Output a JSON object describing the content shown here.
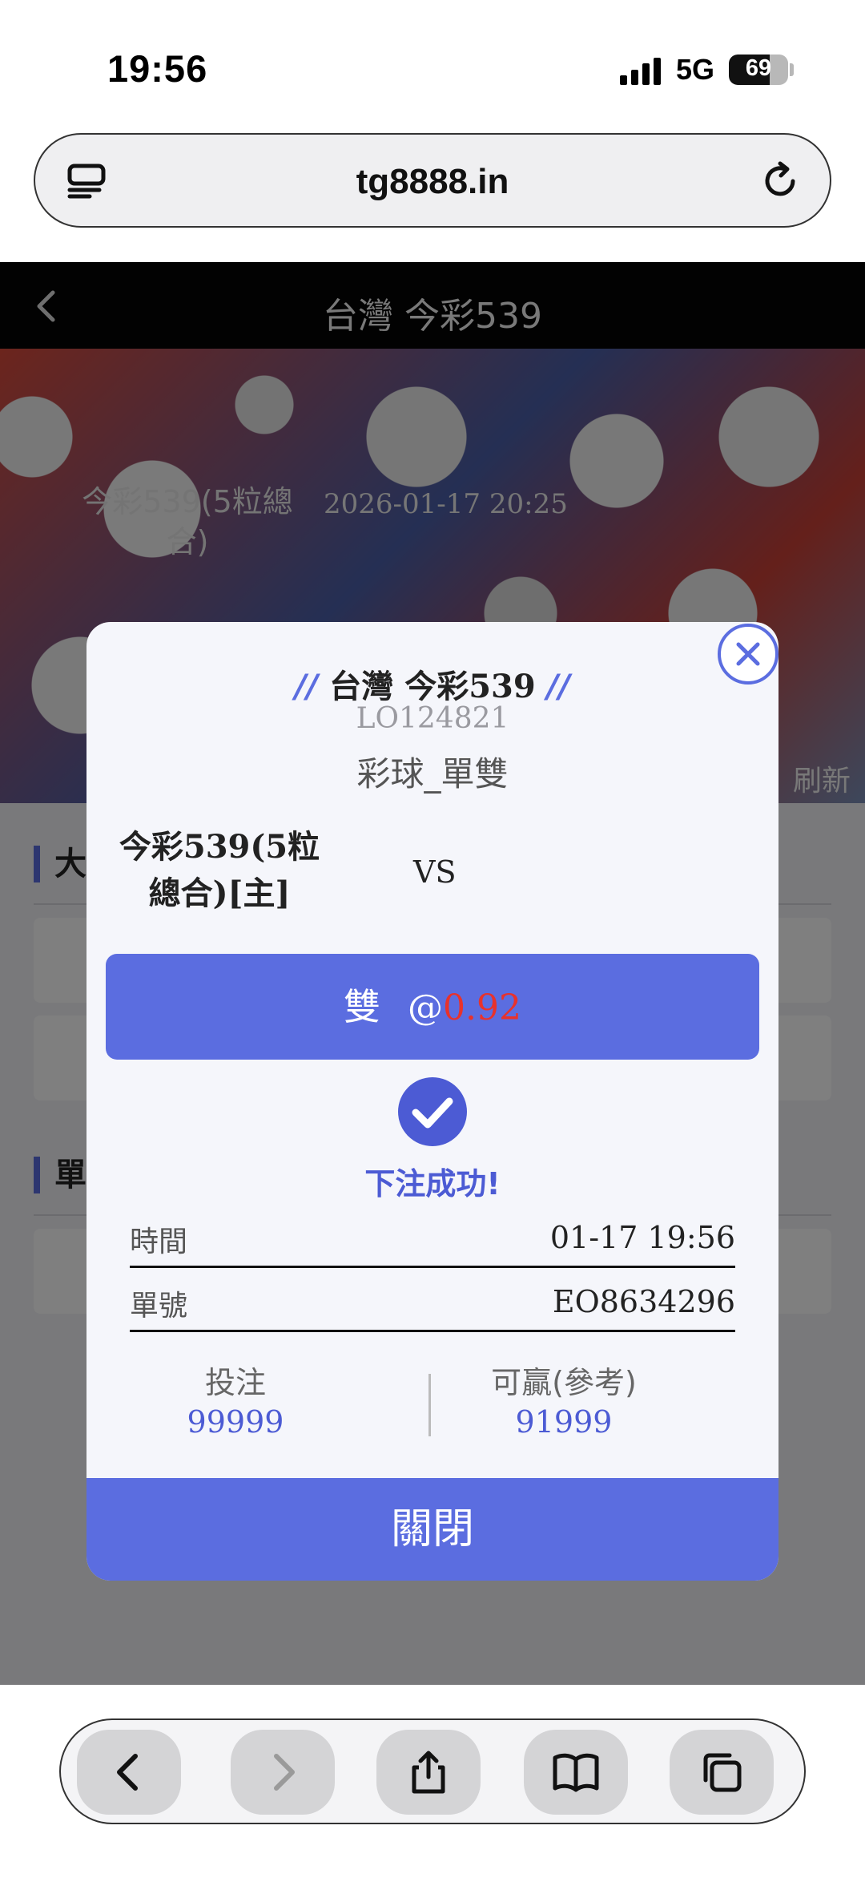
{
  "status_bar": {
    "time": "19:56",
    "network": "5G",
    "battery_level": "69",
    "battery_fraction": 0.69
  },
  "browser": {
    "url": "tg8888.in"
  },
  "page": {
    "title": "台灣 今彩539",
    "hero": {
      "subtitle": "今彩539(5粒總合)",
      "date": "2026-01-17 20:25",
      "refresh": "刷新"
    },
    "sections": [
      "大",
      "單"
    ]
  },
  "modal": {
    "title": "台灣 今彩539",
    "title_deco": "//",
    "code": "LO124821",
    "type": "彩球_單雙",
    "team_home": "今彩539(5粒總合)[主]",
    "vs": "VS",
    "pick": {
      "selection": "雙",
      "at": "@",
      "odds": "0.92"
    },
    "success_text": "下注成功!",
    "rows": [
      {
        "label": "時間",
        "value": "01-17 19:56"
      },
      {
        "label": "單號",
        "value": "EO8634296"
      }
    ],
    "stake": {
      "label": "投注",
      "value": "99999"
    },
    "potential_win": {
      "label": "可贏(參考)",
      "value": "91999"
    },
    "close_label": "關閉"
  },
  "colors": {
    "accent": "#5b6de0",
    "odds": "#e8322c",
    "success": "#4c5bd4"
  },
  "icons": [
    "reader-icon",
    "reload-icon",
    "back-icon",
    "close-icon",
    "check-icon",
    "chevron-left-icon",
    "chevron-right-icon",
    "share-icon",
    "book-icon",
    "tabs-icon"
  ]
}
